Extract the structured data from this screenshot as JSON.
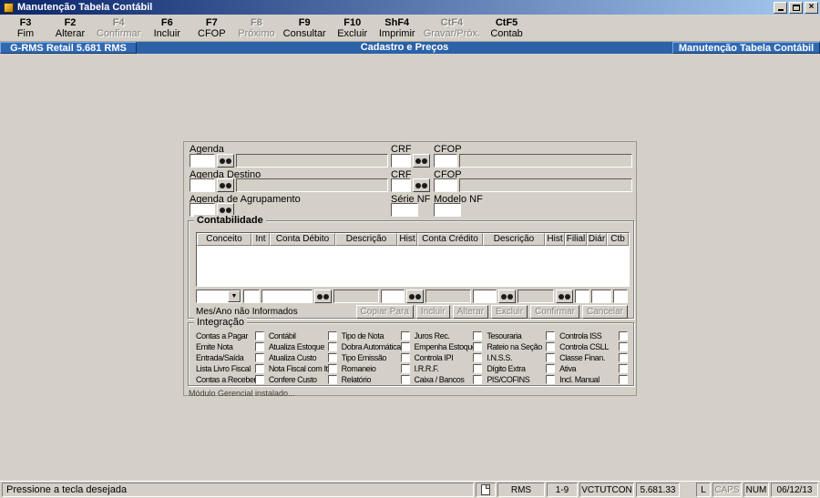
{
  "window": {
    "title": "Manutenção Tabela Contábil"
  },
  "toolbar": {
    "items": [
      {
        "key": "F3",
        "label": "Fim"
      },
      {
        "key": "F2",
        "label": "Alterar"
      },
      {
        "key": "F4",
        "label": "Confirmar"
      },
      {
        "key": "F6",
        "label": "Incluir"
      },
      {
        "key": "F7",
        "label": "CFOP"
      },
      {
        "key": "F8",
        "label": "Próximo"
      },
      {
        "key": "F9",
        "label": "Consultar"
      },
      {
        "key": "F10",
        "label": "Excluir"
      },
      {
        "key": "ShF4",
        "label": "Imprimir"
      },
      {
        "key": "CtF4",
        "label": "Gravar/Próx."
      },
      {
        "key": "CtF5",
        "label": "Contab"
      }
    ]
  },
  "header": {
    "left": "G-RMS Retail 5.681 RMS",
    "center": "Cadastro e Preços",
    "right": "Manutenção Tabela Contábil"
  },
  "form": {
    "labels": {
      "agenda": "Agenda",
      "agenda_destino": "Agenda Destino",
      "agenda_agrupamento": "Agenda de Agrupamento",
      "crf1": "CRF",
      "crf2": "CRF",
      "cfop1": "CFOP",
      "cfop2": "CFOP",
      "serie_nf": "Série NF",
      "modelo_nf": "Modelo NF"
    },
    "contabilidade": {
      "title": "Contabilidade",
      "grid_headers": [
        "Conceito",
        "Int",
        "Conta Débito",
        "Descrição",
        "Hist",
        "Conta Crédito",
        "Descrição",
        "Hist",
        "Filial",
        "Diár",
        "Ctb"
      ],
      "mes_ano_text": "Mes/Ano não Informados",
      "actions": [
        "Copiar Para",
        "Incluir",
        "Alterar",
        "Excluir",
        "Confirmar",
        "Cancelar"
      ]
    },
    "integracao": {
      "title": "Integração",
      "columns": [
        [
          "Contas a Pagar",
          "Emite Nota",
          "Entrada/Saída",
          "Lista Livro Fiscal",
          "Contas a Receber"
        ],
        [
          "Contábil",
          "Atualiza Estoque",
          "Atualiza Custo",
          "Nota Fiscal com Item",
          "Confere Custo"
        ],
        [
          "Tipo de Nota",
          "Dobra Automática",
          "Tipo Emissão",
          "Romaneio",
          "Relatório"
        ],
        [
          "Juros Rec.",
          "Empenha Estoque",
          "Controla IPI",
          "I.R.R.F.",
          "Caixa / Bancos"
        ],
        [
          "Tesouraria",
          "Rateio na Seção",
          "I.N.S.S.",
          "Dígito Extra",
          "PIS/COFINS"
        ],
        [
          "Controla ISS",
          "Controla CSLL",
          "Classe Finan.",
          "Ativa",
          "Incl. Manual"
        ]
      ]
    },
    "module_note": "Módulo Gerencial instalado..."
  },
  "statusbar": {
    "message": "Pressione a tecla desejada",
    "app": "RMS",
    "range": "1-9",
    "program": "VCTUTCON",
    "version": "5.681.33",
    "l_indicator": "L",
    "caps_indicator": "CAPS",
    "num_indicator": "NUM",
    "date": "06/12/13"
  }
}
